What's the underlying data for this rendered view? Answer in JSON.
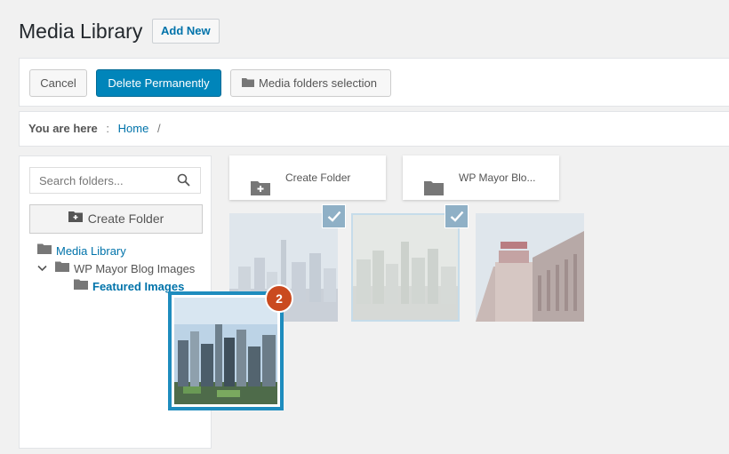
{
  "header": {
    "title": "Media Library",
    "add_new_label": "Add New"
  },
  "toolbar": {
    "cancel_label": "Cancel",
    "delete_label": "Delete Permanently",
    "folders_label": "Media folders selection"
  },
  "breadcrumb": {
    "label": "You are here",
    "separator": ":",
    "home": "Home",
    "trail_end": "/"
  },
  "sidebar": {
    "search_placeholder": "Search folders...",
    "create_folder_label": "Create Folder",
    "tree": [
      {
        "label": "Media Library"
      },
      {
        "label": "WP Mayor Blog Images"
      },
      {
        "label": "Featured Images"
      }
    ]
  },
  "grid": {
    "folder_cards": [
      {
        "label": "Create Folder",
        "icon": "folder-plus-icon"
      },
      {
        "label": "WP Mayor Blo...",
        "icon": "folder-icon"
      }
    ],
    "thumbnails": [
      {
        "name": "city-skyline-1",
        "selected": true
      },
      {
        "name": "city-skyline-2",
        "selected": true
      },
      {
        "name": "new-yorker-building",
        "selected": false
      }
    ]
  },
  "drag": {
    "count": "2"
  },
  "colors": {
    "primary": "#0085ba",
    "link": "#0073aa",
    "badge": "#ca4a1f",
    "drag_border": "#1e8cbe"
  }
}
